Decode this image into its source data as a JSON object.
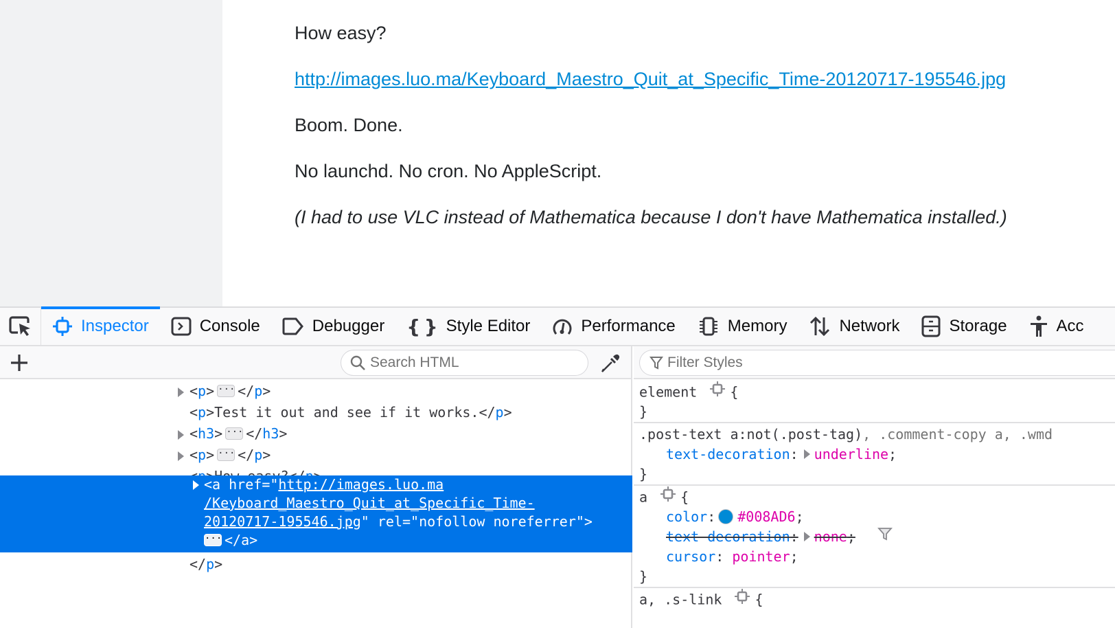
{
  "page": {
    "paragraphs": {
      "how_easy": "How easy?",
      "link_text": "http://images.luo.ma/Keyboard_Maestro_Quit_at_Specific_Time-20120717-195546.jpg",
      "boom": "Boom. Done.",
      "no_launchd": "No launchd. No cron. No AppleScript.",
      "note": "(I had to use VLC instead of Mathematica because I don't have Mathematica installed.)"
    },
    "link_color": "#008AD6"
  },
  "devtools": {
    "toolbar": {
      "picker_icon": "element-picker-icon",
      "tabs": [
        {
          "label": "Inspector",
          "icon": "inspector-icon",
          "active": true
        },
        {
          "label": "Console",
          "icon": "console-icon"
        },
        {
          "label": "Debugger",
          "icon": "debugger-icon"
        },
        {
          "label": "Style Editor",
          "icon": "style-editor-icon"
        },
        {
          "label": "Performance",
          "icon": "performance-icon"
        },
        {
          "label": "Memory",
          "icon": "memory-icon"
        },
        {
          "label": "Network",
          "icon": "network-icon"
        },
        {
          "label": "Storage",
          "icon": "storage-icon"
        },
        {
          "label": "Acc",
          "icon": "accessibility-icon"
        }
      ],
      "accent": "#0A84FF"
    },
    "markup": {
      "search_placeholder": "Search HTML",
      "search_value": "",
      "nodes": [
        {
          "open": "p",
          "collapsed": true,
          "close": "p"
        },
        {
          "open": "p",
          "text": "Test it out and see if it works.",
          "close": "p"
        },
        {
          "open": "h3",
          "collapsed": true,
          "close": "h3"
        },
        {
          "open": "p",
          "collapsed": true,
          "close": "p"
        },
        {
          "open": "p",
          "text": "How easy?",
          "close": "p"
        },
        {
          "open": "p",
          "expanded": true
        }
      ],
      "selected": {
        "tag": "a",
        "href_attr": "href",
        "href_line1": "http://images.luo.ma",
        "href_line2": "/Keyboard_Maestro_Quit_at_Specific_Time-",
        "href_line3": "20120717-195546.jpg",
        "rel_attr": "rel",
        "rel_value": "nofollow noreferrer",
        "close": "a"
      },
      "closing_tag": "p",
      "selection_color": "#0074E8"
    },
    "rules": {
      "filter_placeholder": "Filter Styles",
      "filter_value": "",
      "items": [
        {
          "selector": "element",
          "declarations": []
        },
        {
          "selector_main": ".post-text a:not(.post-tag)",
          "selector_rest": ", .comment-copy a, .wmd",
          "declarations": [
            {
              "prop": "text-decoration",
              "value": "underline"
            }
          ]
        },
        {
          "selector": "a",
          "declarations": [
            {
              "prop": "color",
              "value": "#008AD6"
            },
            {
              "prop": "text-decoration",
              "value": "none",
              "overridden": true
            },
            {
              "prop": "cursor",
              "value": "pointer"
            }
          ]
        },
        {
          "selector": "a, .s-link",
          "declarations": []
        }
      ]
    }
  }
}
